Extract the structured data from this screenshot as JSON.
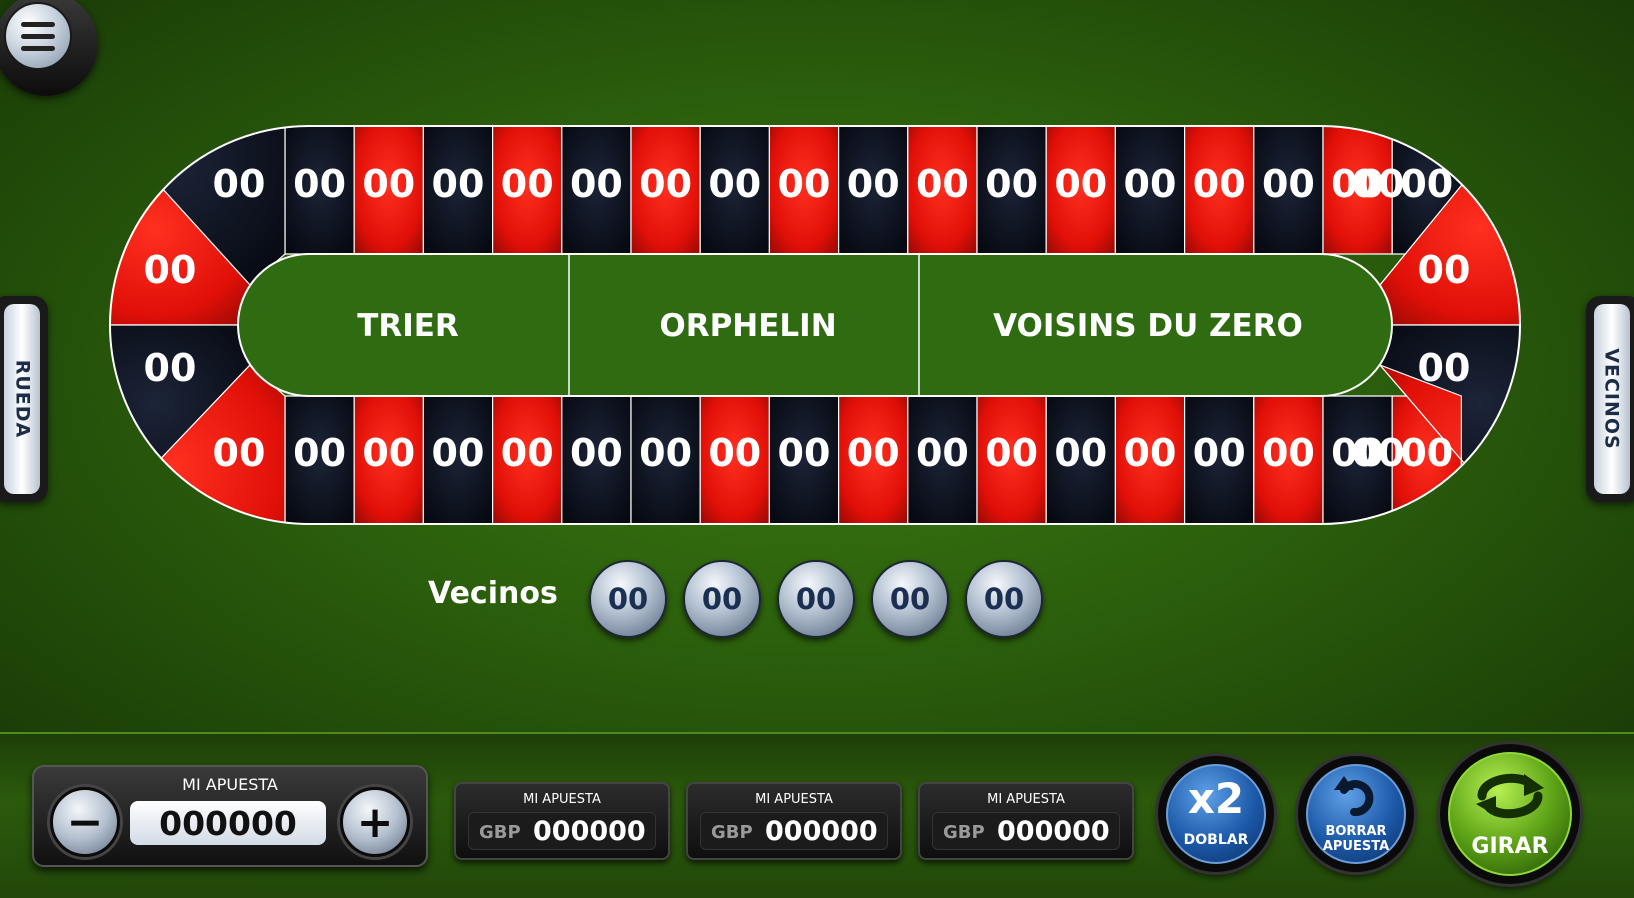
{
  "menu": {
    "icon": "hamburger-menu-icon"
  },
  "side_tabs": {
    "left": "RUEDA",
    "right": "VECINOS"
  },
  "racetrack": {
    "top_row": [
      "00",
      "00",
      "00",
      "00",
      "00",
      "00",
      "00",
      "00",
      "00",
      "00",
      "00",
      "00",
      "00",
      "00",
      "00",
      "00",
      "00",
      "00"
    ],
    "bottom_row": [
      "00",
      "00",
      "00",
      "00",
      "00",
      "00",
      "00",
      "00",
      "00",
      "00",
      "00",
      "00",
      "00",
      "00",
      "00",
      "00",
      "00",
      "00"
    ],
    "left_end": [
      "00",
      "00"
    ],
    "right_end": [
      "00",
      "00"
    ],
    "sections": [
      "TRIER",
      "ORPHELIN",
      "VOISINS DU ZERO"
    ],
    "colors": {
      "red": "#e01010",
      "black": "#0a0f1c",
      "felt": "#2f6b10"
    }
  },
  "vecinos": {
    "label": "Vecinos",
    "values": [
      "00",
      "00",
      "00",
      "00",
      "00"
    ]
  },
  "stake": {
    "title": "MI APUESTA",
    "value": "000000",
    "minus": "−",
    "plus": "+"
  },
  "bets": [
    {
      "title": "MI APUESTA",
      "currency": "GBP",
      "value": "000000"
    },
    {
      "title": "MI APUESTA",
      "currency": "GBP",
      "value": "000000"
    },
    {
      "title": "MI APUESTA",
      "currency": "GBP",
      "value": "000000"
    }
  ],
  "actions": {
    "double": {
      "icon_text": "x2",
      "label": "DOBLAR"
    },
    "clear": {
      "label_line1": "BORRAR",
      "label_line2": "APUESTA"
    },
    "spin": {
      "label": "GIRAR"
    }
  }
}
